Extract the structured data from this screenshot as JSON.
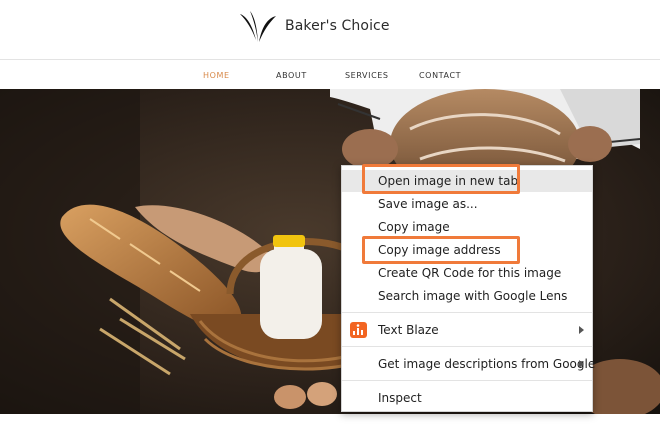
{
  "site": {
    "brand_name": "Baker's Choice",
    "logo_icon": "wing-leaf-logo-icon"
  },
  "nav": {
    "items": [
      {
        "label": "HOME",
        "active": true
      },
      {
        "label": "ABOUT",
        "active": false
      },
      {
        "label": "SERVICES",
        "active": false
      },
      {
        "label": "CONTACT",
        "active": false
      }
    ],
    "active_color": "#d88a4a"
  },
  "context_menu": {
    "items": [
      {
        "label": "Open image in new tab",
        "hovered": true,
        "highlighted": true
      },
      {
        "label": "Save image as...",
        "hovered": false
      },
      {
        "label": "Copy image",
        "hovered": false
      },
      {
        "label": "Copy image address",
        "highlighted": true
      },
      {
        "label": "Create QR Code for this image"
      },
      {
        "label": "Search image with Google Lens"
      },
      {
        "label": "Text Blaze",
        "icon": "text-blaze-icon",
        "submenu": true
      },
      {
        "label": "Get image descriptions from Google",
        "submenu": true
      },
      {
        "label": "Inspect"
      }
    ],
    "highlight_color": "#f07a3a"
  }
}
